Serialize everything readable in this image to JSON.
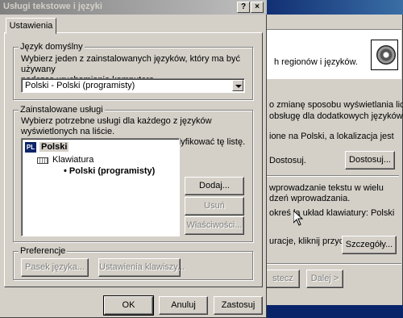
{
  "background_dialog": {
    "header_text": "h regionów i języków.",
    "line1": "o zmianę sposobu wyświetlania liczb,",
    "line2": "obsługę dla dodatkowych języków i",
    "line3": "ione na Polski, a lokalizacja jest",
    "line4": "Dostosuj.",
    "customize_button": "Dostosuj...",
    "line5": "wprowadzanie tekstu w wielu",
    "line6": "dzeń wprowadzania.",
    "line7": "okreś la układ klawiatury: Polski",
    "line8": "uracje, kliknij przycisk",
    "details_button": "Szczegóły...",
    "back_button": "stecz",
    "next_button": "Dalej >"
  },
  "dialog": {
    "title": "Usługi tekstowe i języki",
    "help_button": "?",
    "close_button": "×",
    "tab_settings": "Ustawienia",
    "default_language": {
      "label": "Język domyślny",
      "description_line1": "Wybierz jeden z zainstalowanych języków, który ma być używany",
      "description_line2": "podczas uruchamiania komputera.",
      "selected_value": "Polski - Polski (programisty)"
    },
    "installed_services": {
      "label": "Zainstalowane usługi",
      "description_line1": "Wybierz potrzebne usługi dla każdego z języków wyświetlonych na liście.",
      "description_line2": "Użyj przycisków Dodaj i Usuń, aby zmodyfikować tę listę.",
      "tree": {
        "language_badge": "PL",
        "language": "Polski",
        "category": "Klawiatura",
        "layout": "• Polski (programisty)"
      },
      "add_button": "Dodaj...",
      "remove_button": "Usuń",
      "properties_button": "Właściwości..."
    },
    "preferences": {
      "label": "Preferencje",
      "language_bar_button": "Pasek języka...",
      "key_settings_button": "Ustawienia klawiszy..."
    },
    "ok_button": "OK",
    "cancel_button": "Anuluj",
    "apply_button": "Zastosuj"
  }
}
